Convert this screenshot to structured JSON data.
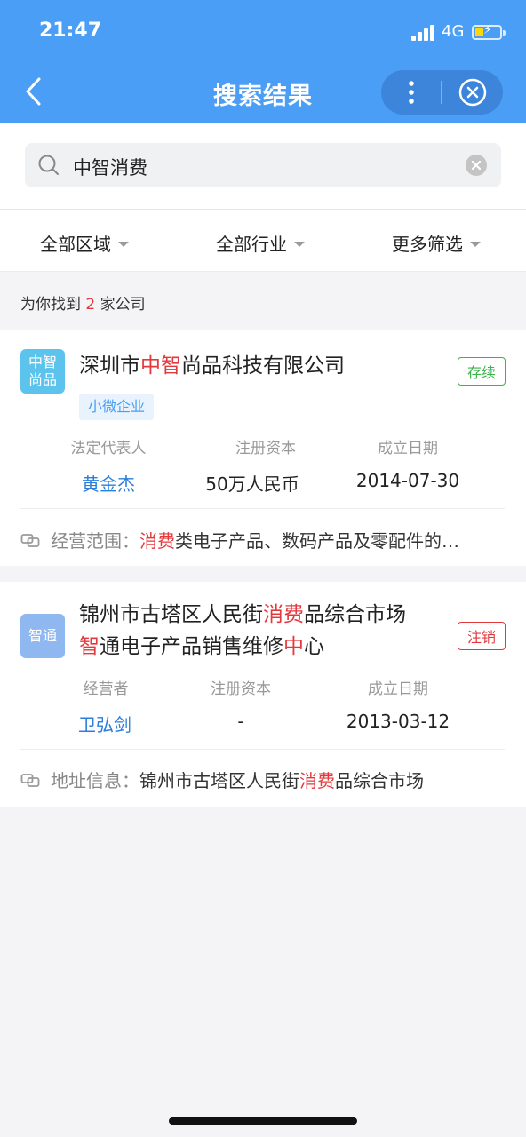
{
  "status_bar": {
    "time": "21:47",
    "network": "4G"
  },
  "nav": {
    "title": "搜索结果"
  },
  "search": {
    "query": "中智消费"
  },
  "filters": [
    {
      "label": "全部区域"
    },
    {
      "label": "全部行业"
    },
    {
      "label": "更多筛选"
    }
  ],
  "result_count": {
    "prefix": "为你找到",
    "count": "2",
    "suffix": "家公司"
  },
  "results": [
    {
      "logo_line1": "中智",
      "logo_line2": "尚品",
      "logo_color": "#5cc3ec",
      "name_parts": [
        "深圳市",
        "中智",
        "尚品科技有限公司"
      ],
      "status": "存续",
      "status_color": "#3bb54a",
      "tag": "小微企业",
      "meta_labels": [
        "法定代表人",
        "注册资本",
        "成立日期"
      ],
      "meta_values": [
        "黄金杰",
        "50万人民币",
        "2014-07-30"
      ],
      "info_label": "经营范围：",
      "info_hl": "消费",
      "info_rest": "类电子产品、数码产品及零配件的…"
    },
    {
      "logo_text": "智通",
      "logo_color": "#8fb7f0",
      "name_line1_parts": [
        "锦州市古塔区人民街",
        "消费",
        "品综合市场"
      ],
      "name_line2_parts": [
        "智",
        "通电子产品销售维修",
        "中",
        "心"
      ],
      "status": "注销",
      "status_color": "#e4393c",
      "meta_labels": [
        "经营者",
        "注册资本",
        "成立日期"
      ],
      "meta_values": [
        "卫弘剑",
        "-",
        "2013-03-12"
      ],
      "info_label": "地址信息：",
      "info_pre": "锦州市古塔区人民街",
      "info_hl": "消费",
      "info_rest": "品综合市场"
    }
  ]
}
